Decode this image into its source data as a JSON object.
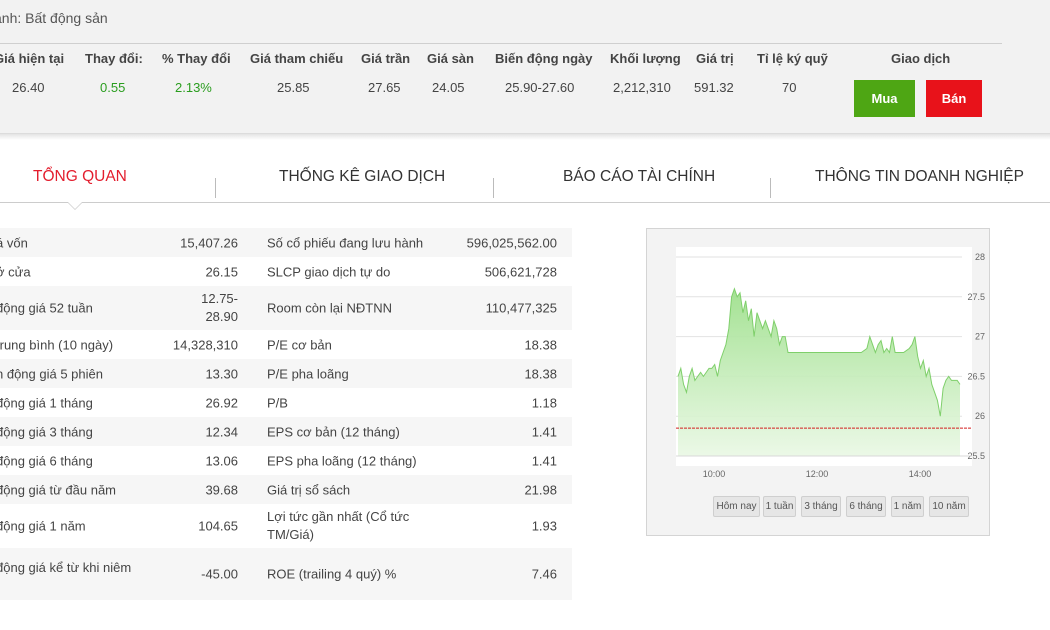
{
  "sector_label": "ành: Bất động sản",
  "quote": {
    "headers": [
      "Giá hiện tại",
      "Thay đổi:",
      "% Thay đổi",
      "Giá tham chiếu",
      "Giá trần",
      "Giá sàn",
      "Biến động ngày",
      "Khối lượng",
      "Giá trị",
      "Tỉ lệ ký quỹ",
      "Giao dịch"
    ],
    "values": [
      "26.40",
      "0.55",
      "2.13%",
      "25.85",
      "27.65",
      "24.05",
      "25.90-27.60",
      "2,212,310",
      "591.32",
      "70"
    ],
    "buy_label": "Mua",
    "sell_label": "Bán"
  },
  "tabs": [
    "TỔNG QUAN",
    "THỐNG KÊ GIAO DỊCH",
    "BÁO CÁO TÀI CHÍNH",
    "THÔNG TIN DOANH NGHIỆP"
  ],
  "stats": [
    {
      "l1": "á vốn",
      "v1": "15,407.26",
      "l2": "Số cổ phiếu đang lưu hành",
      "v2": "596,025,562.00"
    },
    {
      "l1": "ở cửa",
      "v1": "26.15",
      "l2": "SLCP giao dịch tự do",
      "v2": "506,621,728"
    },
    {
      "l1": "động giá 52 tuần",
      "v1": "12.75-28.90",
      "l2": "Room còn lại NĐTNN",
      "v2": "110,477,325"
    },
    {
      "l1": "trung bình (10 ngày)",
      "v1": "14,328,310",
      "l2": "P/E cơ bản",
      "v2": "18.38"
    },
    {
      "l1": "n động giá 5 phiên",
      "v1": "13.30",
      "l2": "P/E pha loãng",
      "v2": "18.38"
    },
    {
      "l1": "động giá 1 tháng",
      "v1": "26.92",
      "l2": "P/B",
      "v2": "1.18"
    },
    {
      "l1": "động giá 3 tháng",
      "v1": "12.34",
      "l2": "EPS cơ bản (12 tháng)",
      "v2": "1.41"
    },
    {
      "l1": "động giá 6 tháng",
      "v1": "13.06",
      "l2": "EPS pha loãng (12 tháng)",
      "v2": "1.41"
    },
    {
      "l1": "động giá từ đầu năm",
      "v1": "39.68",
      "l2": "Giá trị sổ sách",
      "v2": "21.98"
    },
    {
      "l1": "động giá 1 năm",
      "v1": "104.65",
      "l2": "Lợi tức gần nhất (Cổ tức TM/Giá)",
      "v2": "1.93"
    },
    {
      "l1": "động giá kể từ khi niêm",
      "v1": "-45.00",
      "l2": "ROE (trailing 4 quý) %",
      "v2": "7.46"
    }
  ],
  "range_buttons": [
    "Hôm nay",
    "1 tuần",
    "3 tháng",
    "6 tháng",
    "1 năm",
    "10 năm"
  ],
  "colors": {
    "up": "#2a9d1f",
    "buy": "#4ea614",
    "sell": "#e8121a",
    "active_tab": "#e31d2d",
    "area": "#9fe08d",
    "reference_line": "#d21f1f"
  },
  "chart_data": {
    "type": "area",
    "x_ticks": [
      "10:00",
      "12:00",
      "14:00"
    ],
    "y_ticks": [
      "25.5",
      "26",
      "26.5",
      "27",
      "27.5",
      "28"
    ],
    "ylim": [
      25.5,
      28
    ],
    "reference": 25.85,
    "grid": true,
    "x": [
      0,
      0.01,
      0.02,
      0.03,
      0.04,
      0.05,
      0.06,
      0.07,
      0.08,
      0.09,
      0.1,
      0.11,
      0.12,
      0.13,
      0.14,
      0.15,
      0.16,
      0.17,
      0.18,
      0.19,
      0.2,
      0.21,
      0.22,
      0.23,
      0.24,
      0.25,
      0.26,
      0.27,
      0.28,
      0.29,
      0.3,
      0.31,
      0.32,
      0.33,
      0.34,
      0.35,
      0.36,
      0.37,
      0.38,
      0.39,
      0.4,
      0.45,
      0.5,
      0.55,
      0.6,
      0.65,
      0.67,
      0.68,
      0.69,
      0.7,
      0.71,
      0.72,
      0.73,
      0.74,
      0.75,
      0.76,
      0.77,
      0.8,
      0.82,
      0.83,
      0.84,
      0.85,
      0.86,
      0.87,
      0.88,
      0.89,
      0.9,
      0.91,
      0.92,
      0.93,
      0.94,
      0.95,
      0.96,
      0.97,
      0.98,
      0.99,
      1.0
    ],
    "values": [
      26.5,
      26.6,
      26.4,
      26.3,
      26.5,
      26.6,
      26.45,
      26.5,
      26.55,
      26.5,
      26.55,
      26.6,
      26.6,
      26.65,
      26.5,
      26.7,
      26.8,
      26.9,
      27.1,
      27.5,
      27.6,
      27.5,
      27.55,
      27.3,
      27.45,
      27.2,
      27.35,
      27.0,
      27.3,
      27.2,
      27.1,
      27.2,
      27.1,
      27.0,
      27.2,
      27.1,
      26.9,
      27.0,
      27.0,
      26.8,
      26.8,
      26.8,
      26.8,
      26.8,
      26.8,
      26.8,
      26.85,
      27.0,
      26.9,
      26.8,
      26.9,
      26.95,
      26.8,
      26.85,
      26.8,
      27.0,
      26.8,
      26.8,
      26.85,
      26.9,
      27.0,
      26.75,
      26.6,
      26.7,
      26.5,
      26.6,
      26.4,
      26.3,
      26.2,
      26.0,
      26.35,
      26.45,
      26.5,
      26.45,
      26.45,
      26.45,
      26.4
    ]
  }
}
